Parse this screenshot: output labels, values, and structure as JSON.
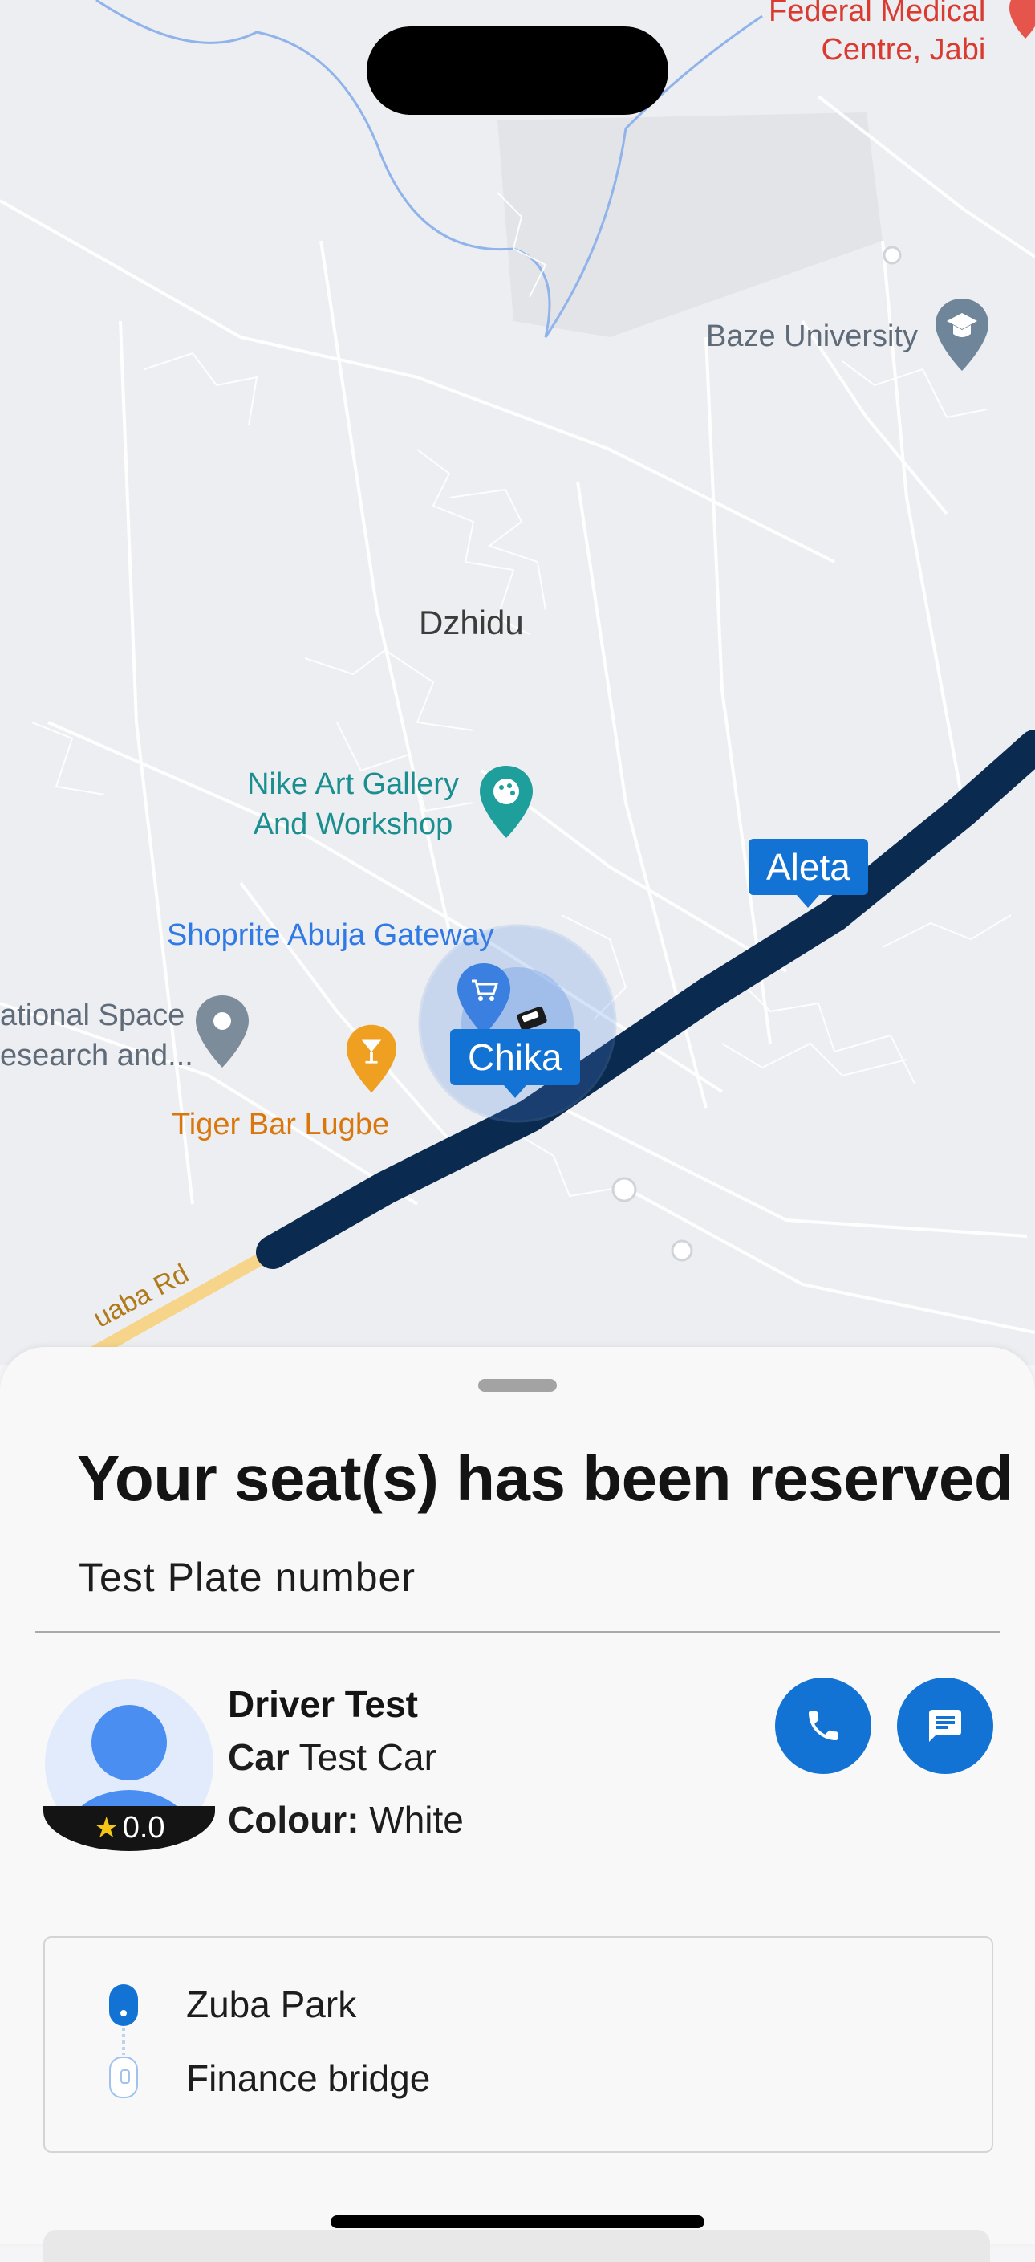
{
  "map": {
    "places": {
      "federal_medical": "Federal Medical\nCentre, Jabi",
      "baze": "Baze University",
      "dzhidu": "Dzhidu",
      "nike": "Nike Art Gallery\nAnd Workshop",
      "shoprite": "Shoprite Abuja Gateway",
      "national_space": "ational Space\nesearch and...",
      "tiger_bar": "Tiger Bar Lugbe",
      "road": "uaba Rd"
    },
    "markers": {
      "destination": "Aleta",
      "origin": "Chika"
    },
    "colors": {
      "route": "#0b2a4f",
      "accent": "#1273d4"
    }
  },
  "sheet": {
    "title": "Your seat(s) has been reserved",
    "plate": "Test Plate number",
    "driver": {
      "name": "Driver Test",
      "car_label": "Car",
      "car_value": "Test Car",
      "colour_label": "Colour:",
      "colour_value": "White",
      "rating": "0.0"
    },
    "actions": {
      "call_icon": "phone-icon",
      "message_icon": "chat-icon"
    },
    "route": {
      "from": "Zuba Park",
      "to": "Finance bridge"
    }
  }
}
